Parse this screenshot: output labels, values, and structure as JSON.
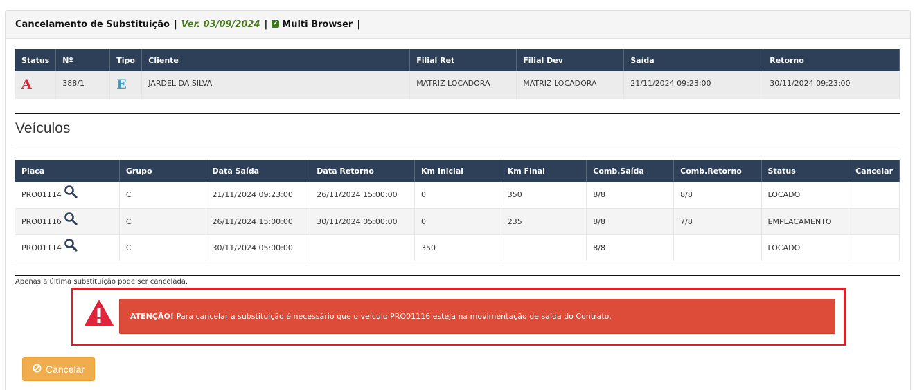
{
  "header": {
    "title": "Cancelamento de Substituição",
    "separator": "|",
    "version": "Ver. 03/09/2024",
    "multi_browser": "Multi Browser"
  },
  "contract_table": {
    "columns": [
      "Status",
      "Nº",
      "Tipo",
      "Cliente",
      "Filial Ret",
      "Filial Dev",
      "Saída",
      "Retorno"
    ],
    "row": {
      "status": "A",
      "numero": "388/1",
      "tipo": "E",
      "cliente": "JARDEL DA SILVA",
      "filial_ret": "MATRIZ LOCADORA",
      "filial_dev": "MATRIZ LOCADORA",
      "saida": "21/11/2024 09:23:00",
      "retorno": "30/11/2024 09:23:00"
    },
    "status_color": "#e0243b",
    "tipo_color": "#2fa3d8"
  },
  "vehicles": {
    "title": "Veículos",
    "columns": [
      "Placa",
      "Grupo",
      "Data Saída",
      "Data Retorno",
      "Km Inicial",
      "Km Final",
      "Comb.Saída",
      "Comb.Retorno",
      "Status",
      "Cancelar"
    ],
    "rows": [
      {
        "placa": "PRO01114",
        "grupo": "C",
        "data_saida": "21/11/2024 09:23:00",
        "data_retorno": "26/11/2024 15:00:00",
        "km_inicial": "0",
        "km_final": "350",
        "comb_saida": "8/8",
        "comb_retorno": "8/8",
        "status": "LOCADO",
        "cancelar": ""
      },
      {
        "placa": "PRO01116",
        "grupo": "C",
        "data_saida": "26/11/2024 15:00:00",
        "data_retorno": "30/11/2024 05:00:00",
        "km_inicial": "0",
        "km_final": "235",
        "comb_saida": "8/8",
        "comb_retorno": "7/8",
        "status": "EMPLACAMENTO",
        "cancelar": ""
      },
      {
        "placa": "PRO01114",
        "grupo": "C",
        "data_saida": "30/11/2024 05:00:00",
        "data_retorno": "",
        "km_inicial": "350",
        "km_final": "",
        "comb_saida": "8/8",
        "comb_retorno": "",
        "status": "LOCADO",
        "cancelar": ""
      }
    ]
  },
  "note": "Apenas a última substituição pode ser cancelada.",
  "alert": {
    "strong": "ATENÇÃO!",
    "message": "Para cancelar a substituição é necessário que o veículo PRO01116 esteja na movimentação de saída do Contrato.",
    "color": "#dd4b39",
    "frame_color": "#d9232b",
    "icon": "warning-triangle-icon"
  },
  "cancel_button": {
    "label": "Cancelar",
    "icon": "ban-icon",
    "color": "#f0ad4e"
  },
  "colors": {
    "table_header": "#2e4057",
    "version_text": "#4a7a1e"
  }
}
